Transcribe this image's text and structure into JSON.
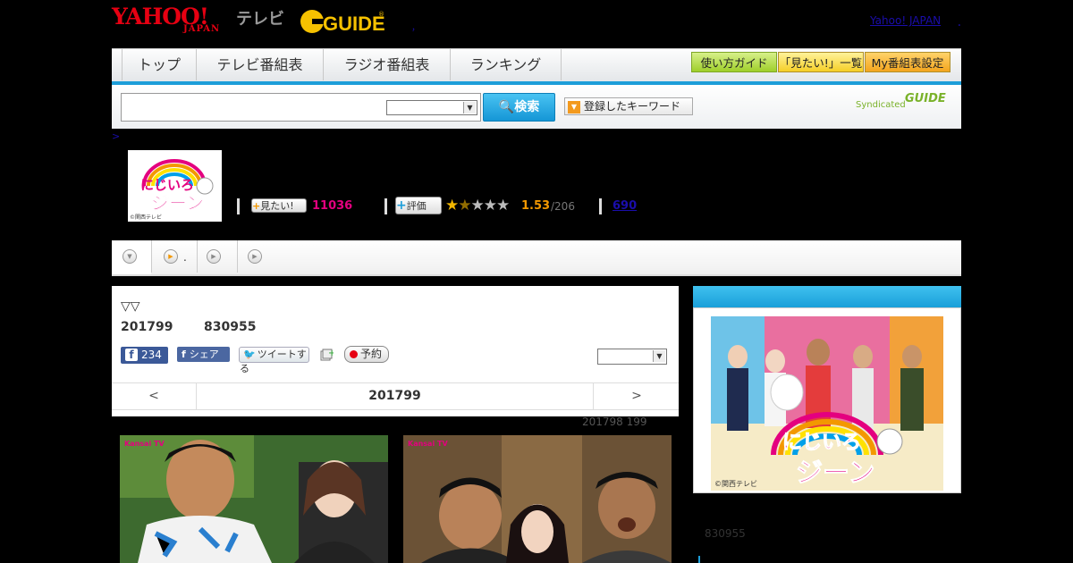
{
  "header": {
    "yahoo_logo": "YAHOO!",
    "yahoo_japan": "JAPAN",
    "tv_label": "テレビ",
    "gguide_logo": "GUIDE",
    "top_link": "Yahoo! JAPAN",
    "top_link_suffix": "．",
    "small_link": "，"
  },
  "nav": {
    "tabs": [
      "トップ",
      "テレビ番組表",
      "ラジオ番組表",
      "ランキング"
    ],
    "utility": [
      "使い方ガイド",
      "「見たい!」一覧",
      "My番組表設定"
    ]
  },
  "search": {
    "placeholder": "",
    "button_label": "検索",
    "keyword_button": "登録したキーワード",
    "syndicated_label": "Syndicated",
    "syndicated_logo": "GUIDE"
  },
  "breadcrumb": ">",
  "program": {
    "logo_text_top": "にじいろ",
    "logo_text_bottom": "ジーン",
    "logo_credit": "©関西テレビ",
    "mitai_label": "見たい!",
    "mitai_count": "11036",
    "hyoka_label": "評価",
    "rating": "1.53",
    "rating_count": "/206",
    "review_link": "690"
  },
  "tabs": {
    "items": [
      ".",
      "",
      ""
    ]
  },
  "episode": {
    "marker": "▽▽",
    "date_a": "201799",
    "date_b": "830955",
    "fb_count": "234",
    "share_label": "シェア",
    "tweet_label": "ツイートする",
    "yoyaku_label": "予約",
    "pager_prev": "<",
    "pager_current": "201799",
    "pager_next": ">",
    "count_line": "201798  199"
  },
  "right_panel": {
    "image_credit": "©関西テレビ",
    "date": "830955"
  },
  "colors": {
    "accent": "#1d9ed9",
    "mitai": "#e3007f",
    "rating": "#f39800",
    "brand_red": "#e60012"
  }
}
